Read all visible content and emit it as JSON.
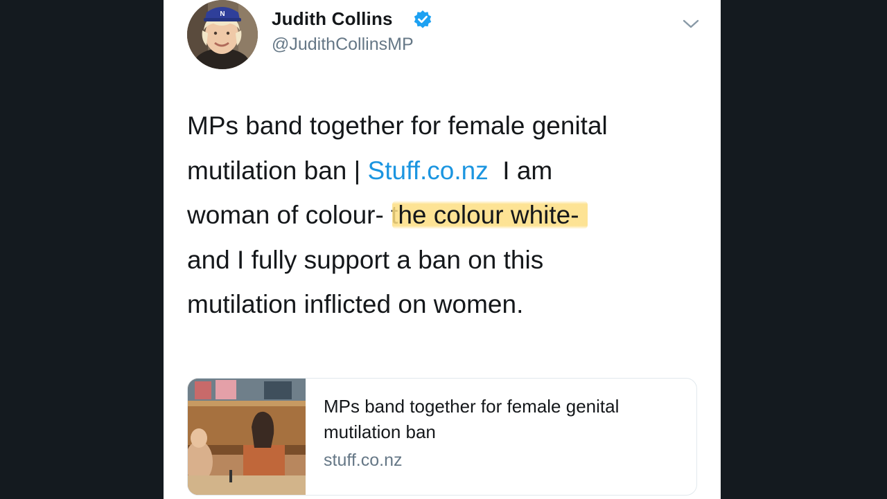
{
  "tweet": {
    "author": {
      "display_name": "Judith Collins",
      "handle": "@JudithCollinsMP",
      "verified": true,
      "avatar_icon": "profile-photo"
    },
    "menu_icon": "chevron-down-icon",
    "text_lines": [
      {
        "before": "MPs band together for female genital",
        "link": "",
        "after": "",
        "highlight": ""
      },
      {
        "before": "mutilation ban | ",
        "link": "Stuff.co.nz",
        "after": "  I am",
        "highlight": ""
      },
      {
        "before": "woman of colour- t",
        "link": "",
        "after": "",
        "highlight": "he colour white-"
      },
      {
        "before": "and I fully support a ban on this",
        "link": "",
        "after": "",
        "highlight": ""
      },
      {
        "before": "mutilation inflicted on women.",
        "link": "",
        "after": "",
        "highlight": ""
      }
    ],
    "link_card": {
      "title": "MPs band together for female genital mutilation ban",
      "domain": "stuff.co.nz"
    }
  },
  "colors": {
    "background": "#141a1f",
    "card": "#ffffff",
    "link": "#1b95e0",
    "verified": "#1da1f2",
    "highlight": "#fdde82",
    "muted": "#657786",
    "text": "#14171a"
  }
}
